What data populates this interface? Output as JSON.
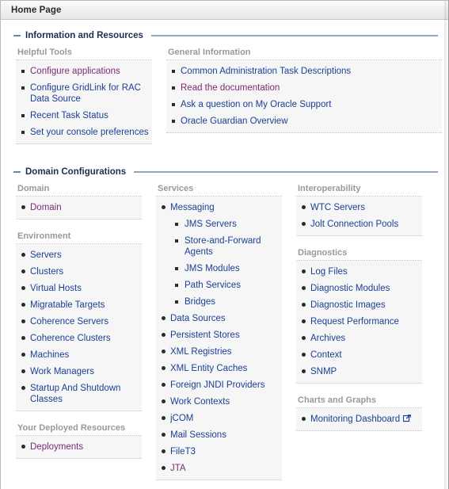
{
  "page": {
    "title": "Home Page"
  },
  "sections": [
    {
      "id": "information-and-resources",
      "title": "Information and Resources",
      "toggle": "collapse-toggle"
    },
    {
      "id": "domain-configurations",
      "title": "Domain Configurations",
      "toggle": "collapse-toggle"
    }
  ],
  "information": {
    "helpful_tools": {
      "title": "Helpful Tools",
      "items": [
        {
          "label": "Configure applications",
          "state": "visited"
        },
        {
          "label": "Configure GridLink for RAC Data Source",
          "state": "normal"
        },
        {
          "label": "Recent Task Status",
          "state": "normal"
        },
        {
          "label": "Set your console preferences",
          "state": "normal"
        }
      ]
    },
    "general_information": {
      "title": "General Information",
      "items": [
        {
          "label": "Common Administration Task Descriptions",
          "state": "normal"
        },
        {
          "label": "Read the documentation",
          "state": "visited"
        },
        {
          "label": "Ask a question on My Oracle Support",
          "state": "normal"
        },
        {
          "label": "Oracle Guardian Overview",
          "state": "normal"
        }
      ]
    }
  },
  "domain_configurations": {
    "domain": {
      "title": "Domain",
      "items": [
        {
          "label": "Domain",
          "state": "visited"
        }
      ]
    },
    "environment": {
      "title": "Environment",
      "items": [
        {
          "label": "Servers",
          "state": "normal"
        },
        {
          "label": "Clusters",
          "state": "normal"
        },
        {
          "label": "Virtual Hosts",
          "state": "normal"
        },
        {
          "label": "Migratable Targets",
          "state": "normal"
        },
        {
          "label": "Coherence Servers",
          "state": "normal"
        },
        {
          "label": "Coherence Clusters",
          "state": "normal"
        },
        {
          "label": "Machines",
          "state": "normal"
        },
        {
          "label": "Work Managers",
          "state": "normal"
        },
        {
          "label": "Startup And Shutdown Classes",
          "state": "normal"
        }
      ]
    },
    "deployed_resources": {
      "title": "Your Deployed Resources",
      "items": [
        {
          "label": "Deployments",
          "state": "visited"
        }
      ]
    },
    "services": {
      "title": "Services",
      "items": [
        {
          "label": "Messaging",
          "state": "normal"
        },
        {
          "label": "Data Sources",
          "state": "normal"
        },
        {
          "label": "Persistent Stores",
          "state": "normal"
        },
        {
          "label": "XML Registries",
          "state": "normal"
        },
        {
          "label": "XML Entity Caches",
          "state": "normal"
        },
        {
          "label": "Foreign JNDI Providers",
          "state": "normal"
        },
        {
          "label": "Work Contexts",
          "state": "normal"
        },
        {
          "label": "jCOM",
          "state": "normal"
        },
        {
          "label": "Mail Sessions",
          "state": "normal"
        },
        {
          "label": "FileT3",
          "state": "normal"
        },
        {
          "label": "JTA",
          "state": "visited"
        }
      ],
      "messaging_children": [
        {
          "label": "JMS Servers",
          "state": "normal"
        },
        {
          "label": "Store-and-Forward Agents",
          "state": "normal"
        },
        {
          "label": "JMS Modules",
          "state": "normal"
        },
        {
          "label": "Path Services",
          "state": "normal"
        },
        {
          "label": "Bridges",
          "state": "normal"
        }
      ]
    },
    "interoperability": {
      "title": "Interoperability",
      "items": [
        {
          "label": "WTC Servers",
          "state": "normal"
        },
        {
          "label": "Jolt Connection Pools",
          "state": "normal"
        }
      ]
    },
    "diagnostics": {
      "title": "Diagnostics",
      "items": [
        {
          "label": "Log Files",
          "state": "normal"
        },
        {
          "label": "Diagnostic Modules",
          "state": "normal"
        },
        {
          "label": "Diagnostic Images",
          "state": "normal"
        },
        {
          "label": "Request Performance",
          "state": "normal"
        },
        {
          "label": "Archives",
          "state": "normal"
        },
        {
          "label": "Context",
          "state": "normal"
        },
        {
          "label": "SNMP",
          "state": "normal"
        }
      ]
    },
    "charts_and_graphs": {
      "title": "Charts and Graphs",
      "items": [
        {
          "label": "Monitoring Dashboard",
          "state": "normal",
          "icon": "external-link-icon"
        }
      ]
    }
  },
  "colors": {
    "link": "#1b3f94",
    "link_visited": "#7c2a74",
    "group_title": "#999999",
    "section_title": "#1c2f4e",
    "section_rule": "#8fa7c7",
    "panel_bg": "#f6f6f6"
  }
}
